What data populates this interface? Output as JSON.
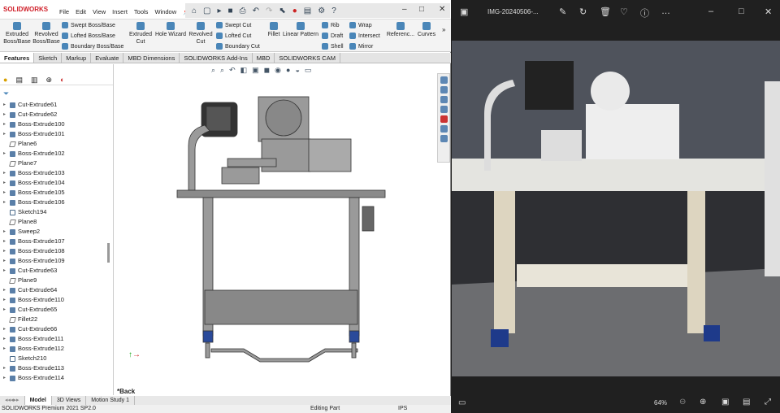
{
  "sw": {
    "logo": "SOLIDWORKS",
    "menu": [
      "File",
      "Edit",
      "View",
      "Insert",
      "Tools",
      "Window"
    ],
    "ribbon": {
      "extruded_boss": "Extruded Boss/Base",
      "revolved_boss": "Revolved Boss/Base",
      "swept_boss": "Swept Boss/Base",
      "lofted_boss": "Lofted Boss/Base",
      "boundary_boss": "Boundary Boss/Base",
      "extruded_cut": "Extruded Cut",
      "hole_wizard": "Hole Wizard",
      "revolved_cut": "Revolved Cut",
      "swept_cut": "Swept Cut",
      "lofted_cut": "Lofted Cut",
      "boundary_cut": "Boundary Cut",
      "fillet": "Fillet",
      "linear_pattern": "Linear Pattern",
      "rib": "Rib",
      "draft": "Draft",
      "shell": "Shell",
      "wrap": "Wrap",
      "intersect": "Intersect",
      "mirror": "Mirror",
      "reference": "Referenc...",
      "curves": "Curves"
    },
    "tabs": [
      "Features",
      "Sketch",
      "Markup",
      "Evaluate",
      "MBD Dimensions",
      "SOLIDWORKS Add-Ins",
      "MBD",
      "SOLIDWORKS CAM"
    ],
    "tree": [
      {
        "t": "cut",
        "l": "Cut-Extrude61"
      },
      {
        "t": "cut",
        "l": "Cut-Extrude62"
      },
      {
        "t": "boss",
        "l": "Boss-Extrude100"
      },
      {
        "t": "boss",
        "l": "Boss-Extrude101"
      },
      {
        "t": "plane",
        "l": "Plane6"
      },
      {
        "t": "boss",
        "l": "Boss-Extrude102"
      },
      {
        "t": "plane",
        "l": "Plane7"
      },
      {
        "t": "boss",
        "l": "Boss-Extrude103"
      },
      {
        "t": "boss",
        "l": "Boss-Extrude104"
      },
      {
        "t": "boss",
        "l": "Boss-Extrude105"
      },
      {
        "t": "boss",
        "l": "Boss-Extrude106"
      },
      {
        "t": "sketch",
        "l": "Sketch194"
      },
      {
        "t": "plane",
        "l": "Plane8"
      },
      {
        "t": "boss",
        "l": "Sweep2"
      },
      {
        "t": "boss",
        "l": "Boss-Extrude107"
      },
      {
        "t": "boss",
        "l": "Boss-Extrude108"
      },
      {
        "t": "boss",
        "l": "Boss-Extrude109"
      },
      {
        "t": "cut",
        "l": "Cut-Extrude63"
      },
      {
        "t": "plane",
        "l": "Plane9"
      },
      {
        "t": "cut",
        "l": "Cut-Extrude64"
      },
      {
        "t": "boss",
        "l": "Boss-Extrude110"
      },
      {
        "t": "cut",
        "l": "Cut-Extrude65"
      },
      {
        "t": "plane",
        "l": "Fillet22"
      },
      {
        "t": "cut",
        "l": "Cut-Extrude66"
      },
      {
        "t": "boss",
        "l": "Boss-Extrude111"
      },
      {
        "t": "boss",
        "l": "Boss-Extrude112"
      },
      {
        "t": "sketch",
        "l": "Sketch210"
      },
      {
        "t": "boss",
        "l": "Boss-Extrude113"
      },
      {
        "t": "boss",
        "l": "Boss-Extrude114"
      }
    ],
    "view_label": "*Back",
    "bottom_tabs": [
      "Model",
      "3D Views",
      "Motion Study 1"
    ],
    "status": {
      "product": "SOLIDWORKS Premium 2021 SP2.0",
      "mode": "Editing Part",
      "units": "IPS"
    }
  },
  "viewer": {
    "title": "IMG-20240506-...",
    "zoom": "64%"
  }
}
